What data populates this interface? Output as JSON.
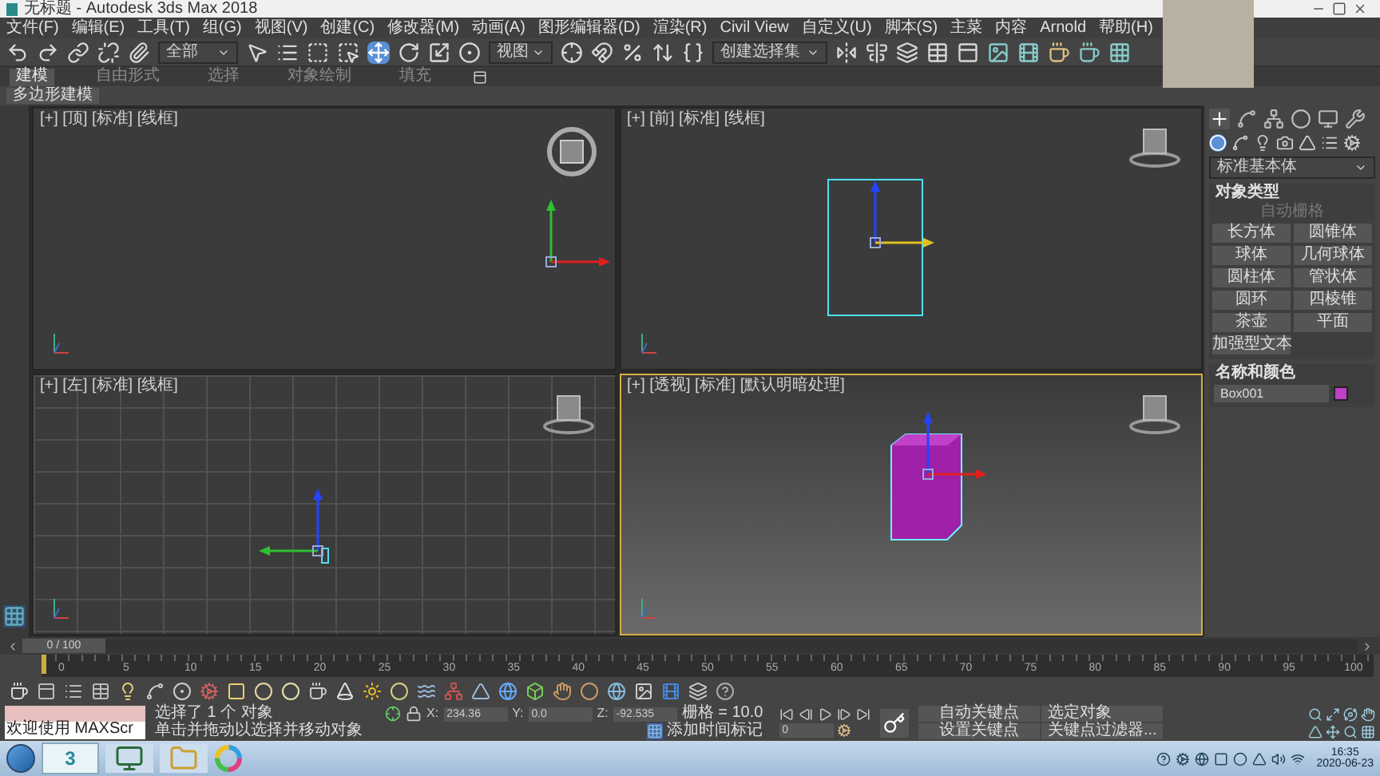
{
  "window": {
    "title": "无标题 - Autodesk 3ds Max 2018"
  },
  "menu": [
    "文件(F)",
    "编辑(E)",
    "工具(T)",
    "组(G)",
    "视图(V)",
    "创建(C)",
    "修改器(M)",
    "动画(A)",
    "图形编辑器(D)",
    "渲染(R)",
    "Civil View",
    "自定义(U)",
    "脚本(S)",
    "主菜",
    "内容",
    "Arnold",
    "帮助(H)"
  ],
  "toolbar": {
    "selection_filter": "全部",
    "reference_coord": "视图",
    "named_selection": "创建选择集",
    "transform_tools": [
      {
        "selected": true
      },
      {
        "selected": false
      },
      {
        "selected": false
      }
    ]
  },
  "ribbon": {
    "tabs": [
      {
        "label": "建模",
        "selected": true
      },
      {
        "label": "自由形式",
        "selected": false
      },
      {
        "label": "选择",
        "selected": false
      },
      {
        "label": "对象绘制",
        "selected": false
      },
      {
        "label": "填充",
        "selected": false
      }
    ],
    "panel": "多边形建模"
  },
  "viewports": [
    {
      "label": "[+] [顶] [标准] [线框]",
      "kind": "top",
      "selected": false
    },
    {
      "label": "[+] [前] [标准] [线框]",
      "kind": "front",
      "selected": false
    },
    {
      "label": "[+] [左] [标准] [线框]",
      "kind": "left",
      "selected": false
    },
    {
      "label": "[+] [透视] [标准] [默认明暗处理]",
      "kind": "perspective",
      "selected": true
    }
  ],
  "command_panel": {
    "tabs": [
      {
        "selected": true
      },
      {
        "selected": false
      },
      {
        "selected": false
      },
      {
        "selected": false
      },
      {
        "selected": false
      },
      {
        "selected": false
      }
    ],
    "categories": [
      {
        "selected": true
      },
      {
        "selected": false
      },
      {
        "selected": false
      },
      {
        "selected": false
      },
      {
        "selected": false
      },
      {
        "selected": false
      },
      {
        "selected": false
      }
    ],
    "category": "标准基本体",
    "object_type": {
      "title": "对象类型",
      "autogrid": "自动栅格",
      "buttons": [
        "长方体",
        "圆锥体",
        "球体",
        "几何球体",
        "圆柱体",
        "管状体",
        "圆环",
        "四棱锥",
        "茶壶",
        "平面",
        "加强型文本"
      ]
    },
    "name_color": {
      "title": "名称和颜色",
      "name": "Box001",
      "color": "#c23fc8"
    }
  },
  "timeline": {
    "frame": "0 / 100",
    "level": 0,
    "ticks": [
      "0",
      "5",
      "10",
      "15",
      "20",
      "25",
      "30",
      "35",
      "40",
      "45",
      "50",
      "55",
      "60",
      "65",
      "70",
      "75",
      "80",
      "85",
      "90",
      "95",
      "100"
    ]
  },
  "status": {
    "script_output": "欢迎使用 MAXScr",
    "selection": "选择了 1 个 对象",
    "prompt": "单击并拖动以选择并移动对象",
    "coords": [
      {
        "label": "X:",
        "value": "234.36"
      },
      {
        "label": "Y:",
        "value": "0.0"
      },
      {
        "label": "Z:",
        "value": "-92.535"
      }
    ],
    "grid": "栅格 = 10.0",
    "add_time_tag": "添加时间标记",
    "frame": "0",
    "auto_key": "自动关键点",
    "key_mode": "选定对象",
    "set_key": "设置关键点",
    "key_filters": "关键点过滤器..."
  },
  "taskbar": {
    "max_icon_label": "3",
    "time": "16:35",
    "date": "2020-06-23"
  }
}
